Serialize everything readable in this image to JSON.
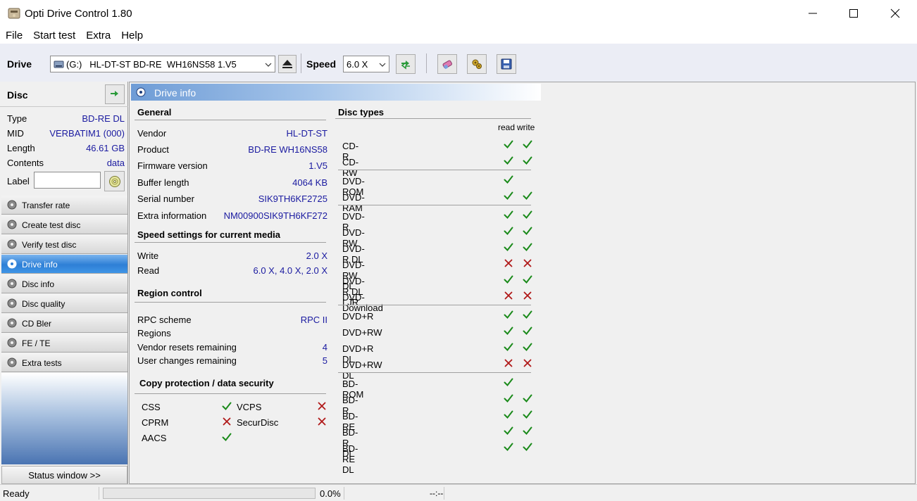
{
  "window": {
    "title": "Opti Drive Control 1.80"
  },
  "menu": [
    "File",
    "Start test",
    "Extra",
    "Help"
  ],
  "toolbar": {
    "drive_label": "Drive",
    "drive_value": "(G:)   HL-DT-ST BD-RE  WH16NS58 1.V5",
    "speed_label": "Speed",
    "speed_value": "6.0 X"
  },
  "disc": {
    "title": "Disc",
    "rows": [
      {
        "k": "Type",
        "v": "BD-RE DL"
      },
      {
        "k": "MID",
        "v": "VERBATIM1 (000)"
      },
      {
        "k": "Length",
        "v": "46.61 GB"
      },
      {
        "k": "Contents",
        "v": "data"
      }
    ],
    "label_caption": "Label"
  },
  "nav": [
    "Transfer rate",
    "Create test disc",
    "Verify test disc",
    "Drive info",
    "Disc info",
    "Disc quality",
    "CD Bler",
    "FE / TE",
    "Extra tests"
  ],
  "status_window_button": "Status window >>",
  "panel": {
    "title": "Drive info",
    "general_title": "General",
    "general": [
      {
        "k": "Vendor",
        "v": "HL-DT-ST"
      },
      {
        "k": "Product",
        "v": "BD-RE  WH16NS58"
      },
      {
        "k": "Firmware version",
        "v": "1.V5"
      },
      {
        "k": "Buffer length",
        "v": "4064 KB"
      },
      {
        "k": "Serial number",
        "v": "SIK9TH6KF2725"
      },
      {
        "k": "Extra information",
        "v": "NM00900SIK9TH6KF272"
      }
    ],
    "speed_title": "Speed settings for current media",
    "speed": [
      {
        "k": "Write",
        "v": "2.0 X"
      },
      {
        "k": "Read",
        "v": "6.0 X, 4.0 X, 2.0 X"
      }
    ],
    "region_title": "Region control",
    "region": [
      {
        "k": "RPC scheme",
        "v": "RPC II"
      },
      {
        "k": "Regions",
        "v": ""
      },
      {
        "k": "Vendor resets remaining",
        "v": "4"
      },
      {
        "k": "User changes remaining",
        "v": "5"
      }
    ],
    "copy_title": "Copy protection / data security",
    "copy": [
      {
        "name": "CSS",
        "ok": true
      },
      {
        "name": "VCPS",
        "ok": false
      },
      {
        "name": "CPRM",
        "ok": false
      },
      {
        "name": "SecurDisc",
        "ok": false
      },
      {
        "name": "AACS",
        "ok": true
      }
    ],
    "disc_types_title": "Disc types",
    "read_label": "read",
    "write_label": "write",
    "disc_types": [
      {
        "name": "CD-R",
        "read": "yes",
        "write": "yes"
      },
      {
        "name": "CD-RW",
        "read": "yes",
        "write": "yes"
      },
      {
        "name": "DVD-ROM",
        "read": "yes",
        "write": "none"
      },
      {
        "name": "DVD-RAM",
        "read": "yes",
        "write": "yes"
      },
      {
        "name": "DVD-R",
        "read": "yes",
        "write": "yes"
      },
      {
        "name": "DVD-RW",
        "read": "yes",
        "write": "yes"
      },
      {
        "name": "DVD-R DL",
        "read": "yes",
        "write": "yes"
      },
      {
        "name": "DVD-RW DL",
        "read": "no",
        "write": "no"
      },
      {
        "name": "DVD-R DL LJR",
        "read": "yes",
        "write": "yes"
      },
      {
        "name": "DVD-Download",
        "read": "no",
        "write": "no"
      },
      {
        "name": "DVD+R",
        "read": "yes",
        "write": "yes"
      },
      {
        "name": "DVD+RW",
        "read": "yes",
        "write": "yes"
      },
      {
        "name": "DVD+R DL",
        "read": "yes",
        "write": "yes"
      },
      {
        "name": "DVD+RW DL",
        "read": "no",
        "write": "no"
      },
      {
        "name": "BD-ROM",
        "read": "yes",
        "write": "none"
      },
      {
        "name": "BD-R",
        "read": "yes",
        "write": "yes"
      },
      {
        "name": "BD-RE",
        "read": "yes",
        "write": "yes"
      },
      {
        "name": "BD-R DL",
        "read": "yes",
        "write": "yes"
      },
      {
        "name": "BD-RE DL",
        "read": "yes",
        "write": "yes"
      }
    ]
  },
  "statusbar": {
    "status": "Ready",
    "progress_percent": 0,
    "progress_text": "0.0%",
    "time": "--:--"
  },
  "colors": {
    "check": "#1a8a1a",
    "cross": "#b01818",
    "value_text": "#1a1aa0",
    "active_nav": "#2e7fd6"
  }
}
